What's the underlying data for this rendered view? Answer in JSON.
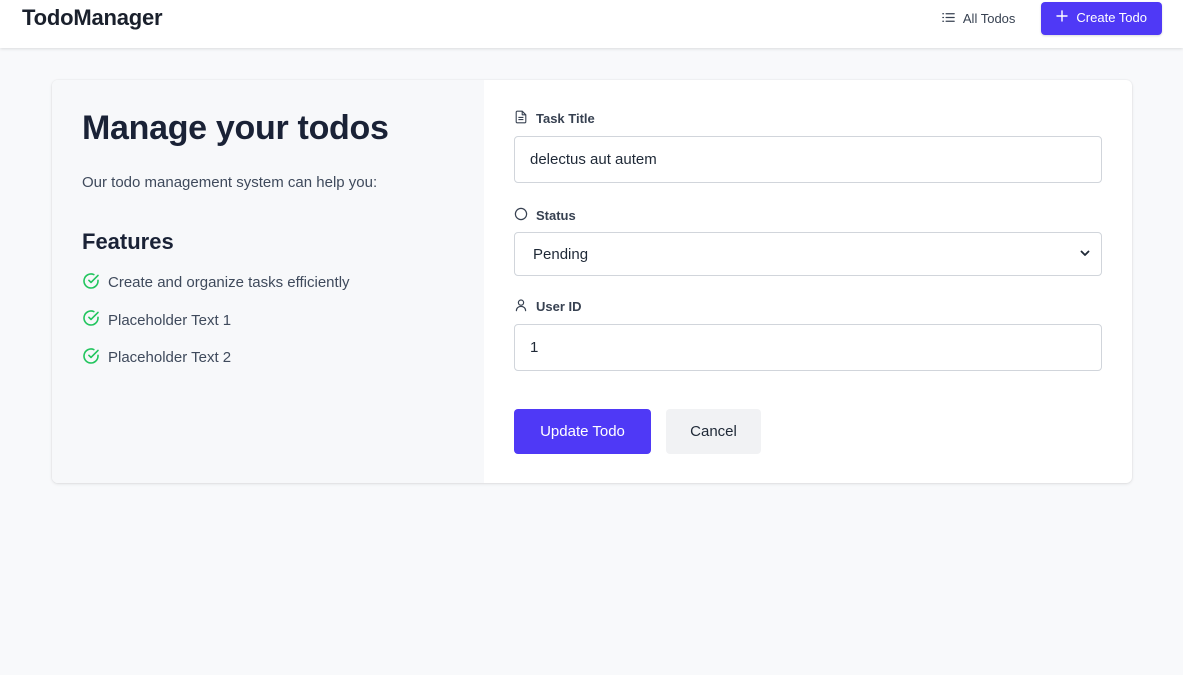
{
  "app": {
    "brand": "TodoManager"
  },
  "nav": {
    "all_todos": {
      "label": "All Todos",
      "icon": "list-icon"
    },
    "create_todo": {
      "label": "Create Todo",
      "icon": "plus-icon"
    }
  },
  "intro": {
    "title": "Manage your todos",
    "subtitle": "Our todo management system can help you:",
    "features_heading": "Features",
    "features": [
      {
        "text": "Create and organize tasks efficiently",
        "icon": "check-circle-icon"
      },
      {
        "text": "Placeholder Text 1",
        "icon": "check-circle-icon"
      },
      {
        "text": "Placeholder Text 2",
        "icon": "check-circle-icon"
      }
    ]
  },
  "form": {
    "title_field": {
      "label": "Task Title",
      "value": "delectus aut autem",
      "icon": "document-icon"
    },
    "status_field": {
      "label": "Status",
      "value": "Pending",
      "icon": "circle-icon"
    },
    "user_field": {
      "label": "User ID",
      "value": "1",
      "icon": "user-icon"
    },
    "submit_label": "Update Todo",
    "cancel_label": "Cancel"
  },
  "colors": {
    "accent": "#4f39f6",
    "success": "#22c55e",
    "heading": "#1a2236",
    "background": "#f8f9fb"
  }
}
